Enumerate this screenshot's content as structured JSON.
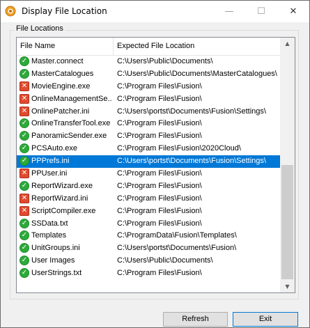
{
  "window": {
    "title": "Display File Location"
  },
  "titlebar": {
    "minimize": "—",
    "maximize": "☐",
    "close": "✕"
  },
  "group": {
    "label": "File Locations"
  },
  "columns": {
    "name": "File Name",
    "location": "Expected File Location"
  },
  "rows": [
    {
      "status": "ok",
      "name": "Master.connect",
      "location": "C:\\Users\\Public\\Documents\\"
    },
    {
      "status": "ok",
      "name": "MasterCatalogues",
      "location": "C:\\Users\\Public\\Documents\\MasterCatalogues\\"
    },
    {
      "status": "err",
      "name": "MovieEngine.exe",
      "location": "C:\\Program Files\\Fusion\\"
    },
    {
      "status": "err",
      "name": "OnlineManagementSe...",
      "location": "C:\\Program Files\\Fusion\\"
    },
    {
      "status": "err",
      "name": "OnlinePatcher.ini",
      "location": "C:\\Users\\portst\\Documents\\Fusion\\Settings\\"
    },
    {
      "status": "ok",
      "name": "OnlineTransferTool.exe",
      "location": "C:\\Program Files\\Fusion\\"
    },
    {
      "status": "ok",
      "name": "PanoramicSender.exe",
      "location": "C:\\Program Files\\Fusion\\"
    },
    {
      "status": "ok",
      "name": "PCSAuto.exe",
      "location": "C:\\Program Files\\Fusion\\2020Cloud\\"
    },
    {
      "status": "ok",
      "name": "PPPrefs.ini",
      "location": "C:\\Users\\portst\\Documents\\Fusion\\Settings\\",
      "selected": true
    },
    {
      "status": "err",
      "name": "PPUser.ini",
      "location": "C:\\Program Files\\Fusion\\"
    },
    {
      "status": "ok",
      "name": "ReportWizard.exe",
      "location": "C:\\Program Files\\Fusion\\"
    },
    {
      "status": "err",
      "name": "ReportWizard.ini",
      "location": "C:\\Program Files\\Fusion\\"
    },
    {
      "status": "err",
      "name": "ScriptCompiler.exe",
      "location": "C:\\Program Files\\Fusion\\"
    },
    {
      "status": "ok",
      "name": "SSData.txt",
      "location": "C:\\Program Files\\Fusion\\"
    },
    {
      "status": "ok",
      "name": "Templates",
      "location": "C:\\ProgramData\\Fusion\\Templates\\"
    },
    {
      "status": "ok",
      "name": "UnitGroups.ini",
      "location": "C:\\Users\\portst\\Documents\\Fusion\\"
    },
    {
      "status": "ok",
      "name": "User Images",
      "location": "C:\\Users\\Public\\Documents\\"
    },
    {
      "status": "ok",
      "name": "UserStrings.txt",
      "location": "C:\\Program Files\\Fusion\\"
    }
  ],
  "icons": {
    "ok": "check-circle-icon",
    "err": "error-x-icon"
  },
  "colors": {
    "ok": "#2eaa3a",
    "err": "#e04a2e",
    "selection": "#0078d7"
  },
  "buttons": {
    "refresh": "Refresh",
    "exit": "Exit"
  }
}
